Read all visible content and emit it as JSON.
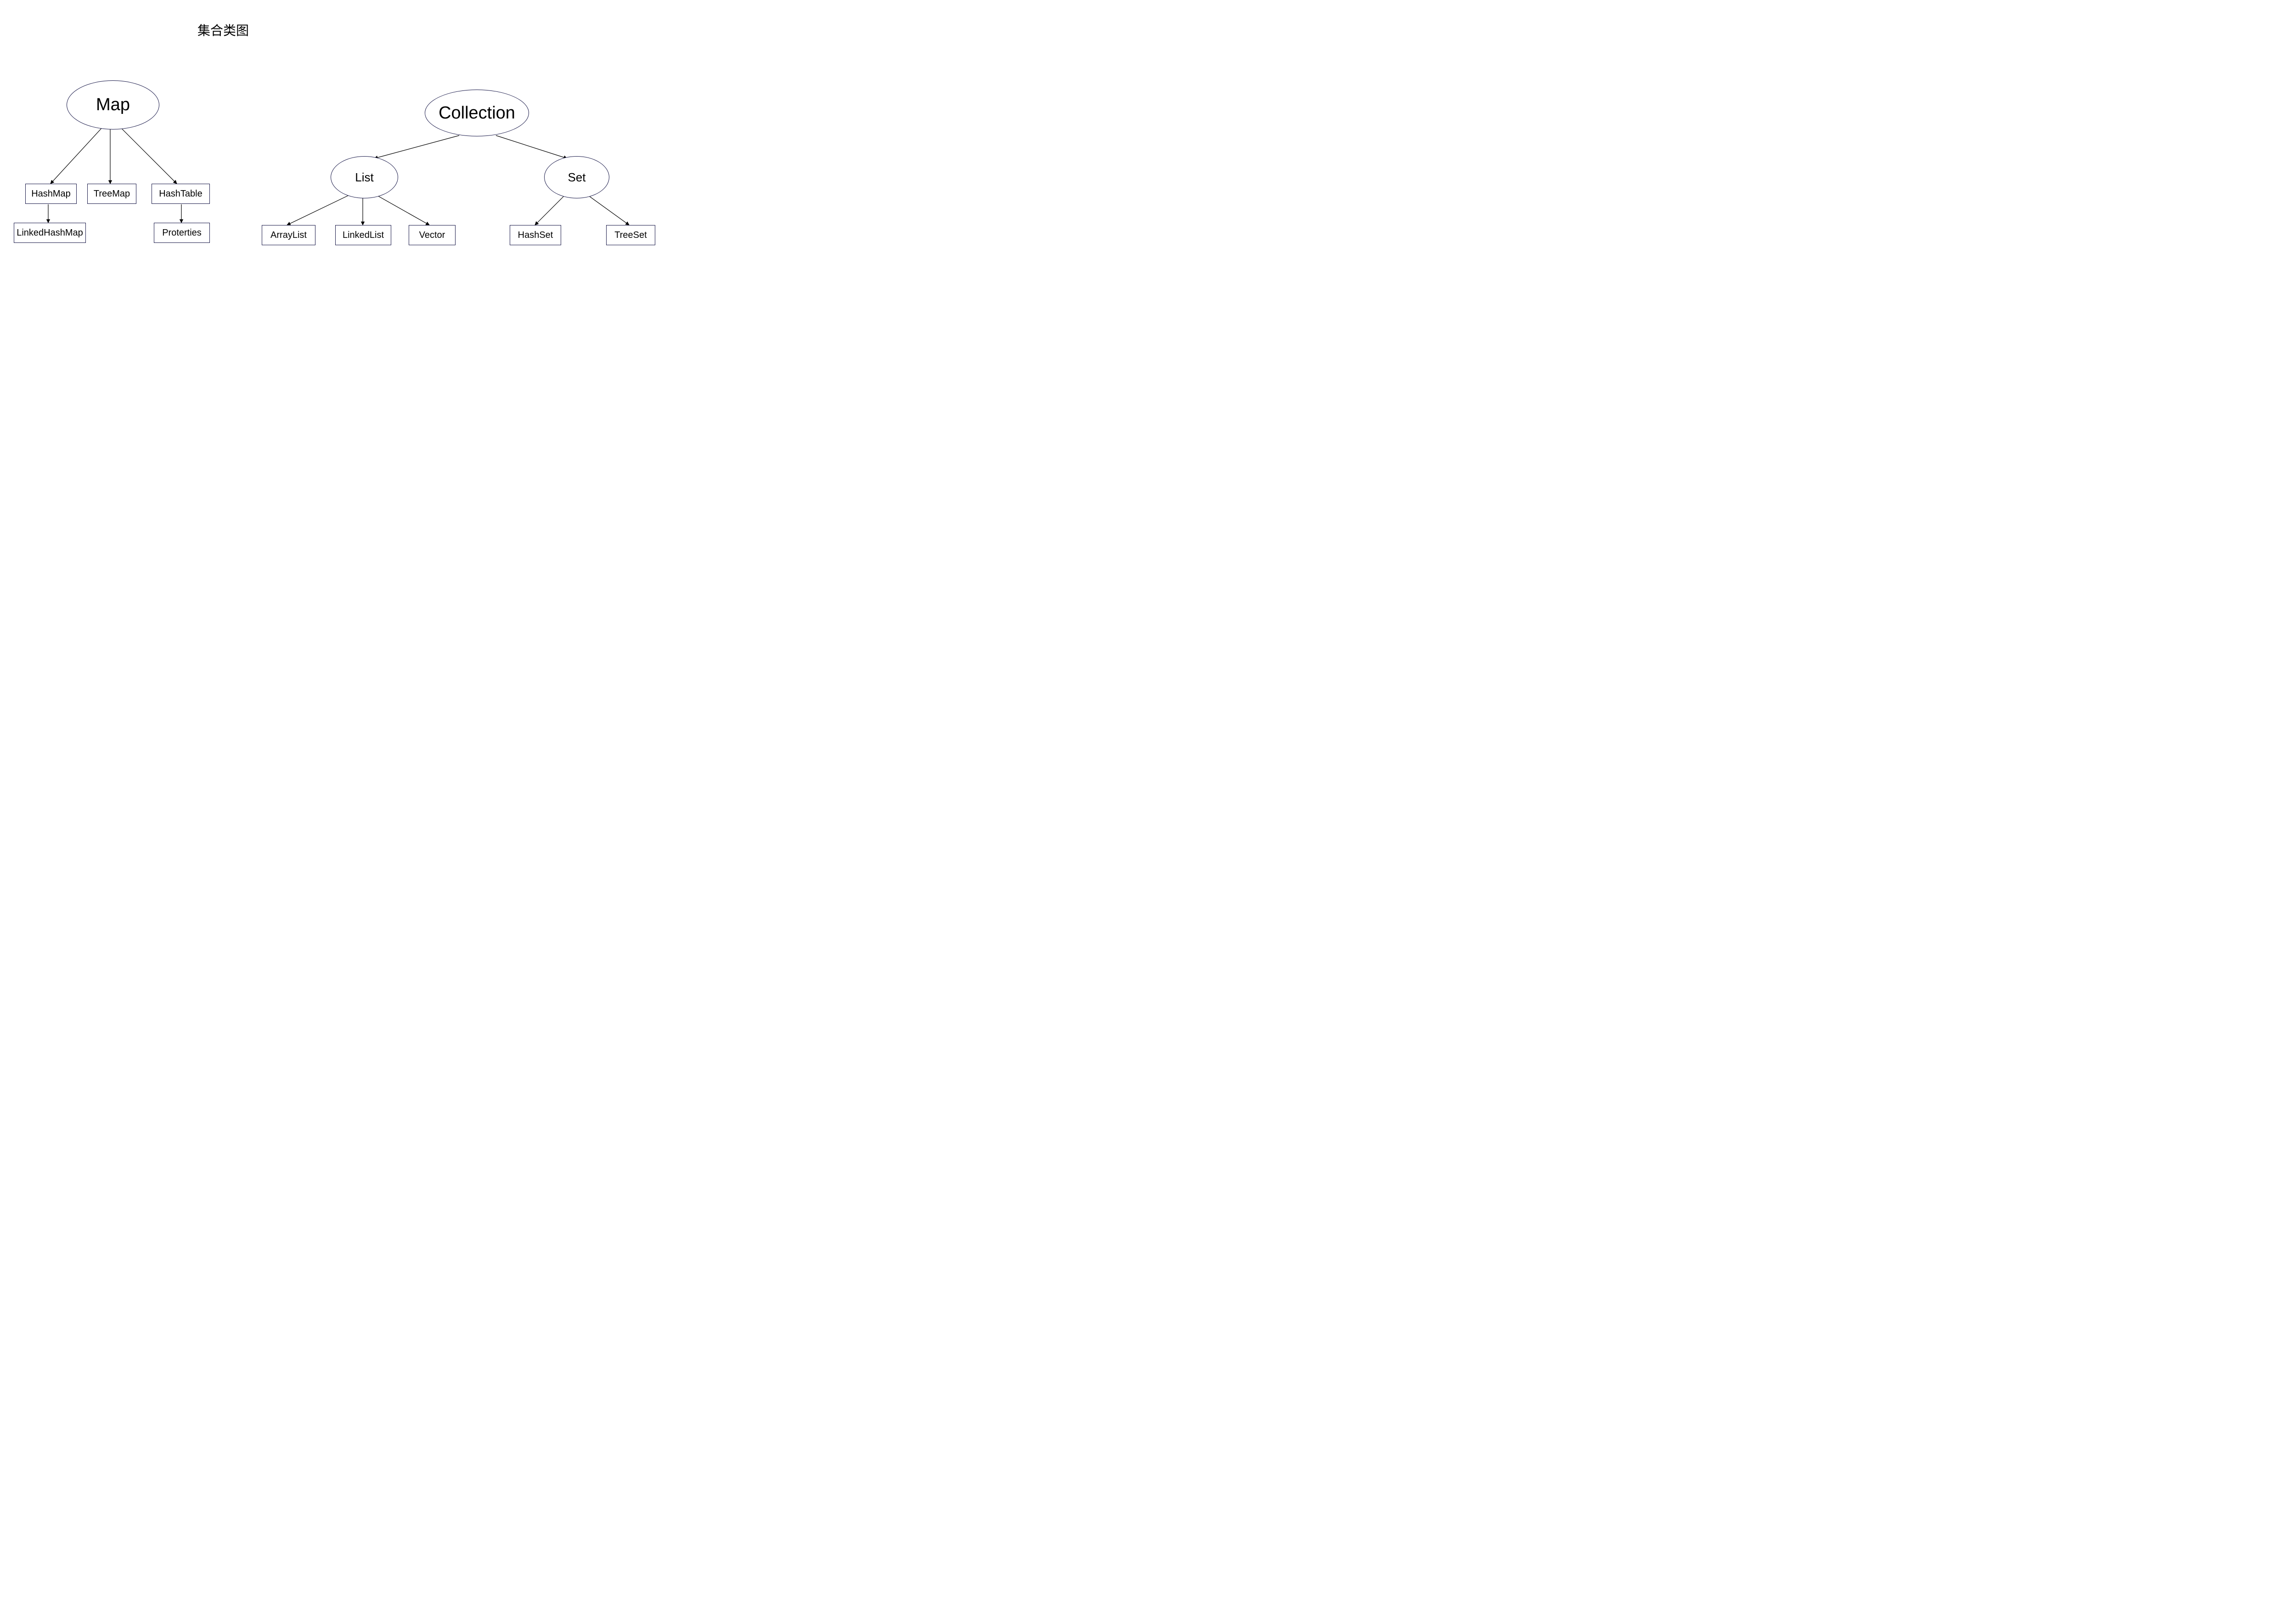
{
  "title": "集合类图",
  "nodes": {
    "map": "Map",
    "hashmap": "HashMap",
    "treemap": "TreeMap",
    "hashtable": "HashTable",
    "linkedhashmap": "LinkedHashMap",
    "properties": "Proterties",
    "collection": "Collection",
    "list": "List",
    "set": "Set",
    "arraylist": "ArrayList",
    "linkedlist": "LinkedList",
    "vector": "Vector",
    "hashset": "HashSet",
    "treeset": "TreeSet"
  }
}
